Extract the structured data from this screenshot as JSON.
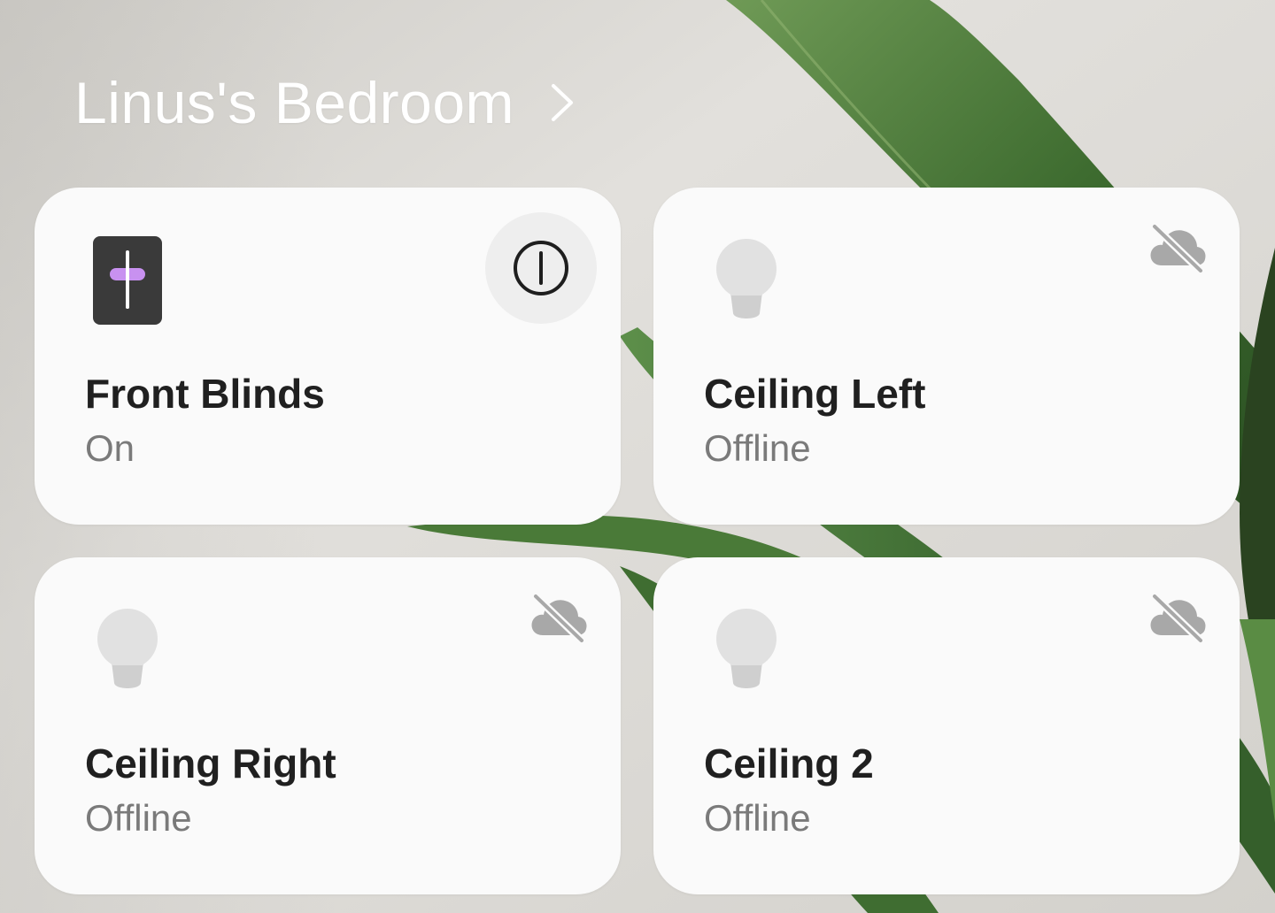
{
  "room": {
    "title": "Linus's Bedroom",
    "chevron_icon": "chevron-right-icon"
  },
  "devices": [
    {
      "name": "Front Blinds",
      "status": "On",
      "icon": "blinds-icon",
      "action_icon": "power-icon",
      "accent": "#c891f0"
    },
    {
      "name": "Ceiling Left",
      "status": "Offline",
      "icon": "light-bulb-icon",
      "action_icon": "cloud-off-icon"
    },
    {
      "name": "Ceiling Right",
      "status": "Offline",
      "icon": "light-bulb-icon",
      "action_icon": "cloud-off-icon"
    },
    {
      "name": "Ceiling 2",
      "status": "Offline",
      "icon": "light-bulb-icon",
      "action_icon": "cloud-off-icon"
    }
  ],
  "colors": {
    "card_bg": "#fafafa",
    "title_text": "#202020",
    "status_text": "#7a7a7a",
    "offline_icon": "#a8a8a8"
  }
}
